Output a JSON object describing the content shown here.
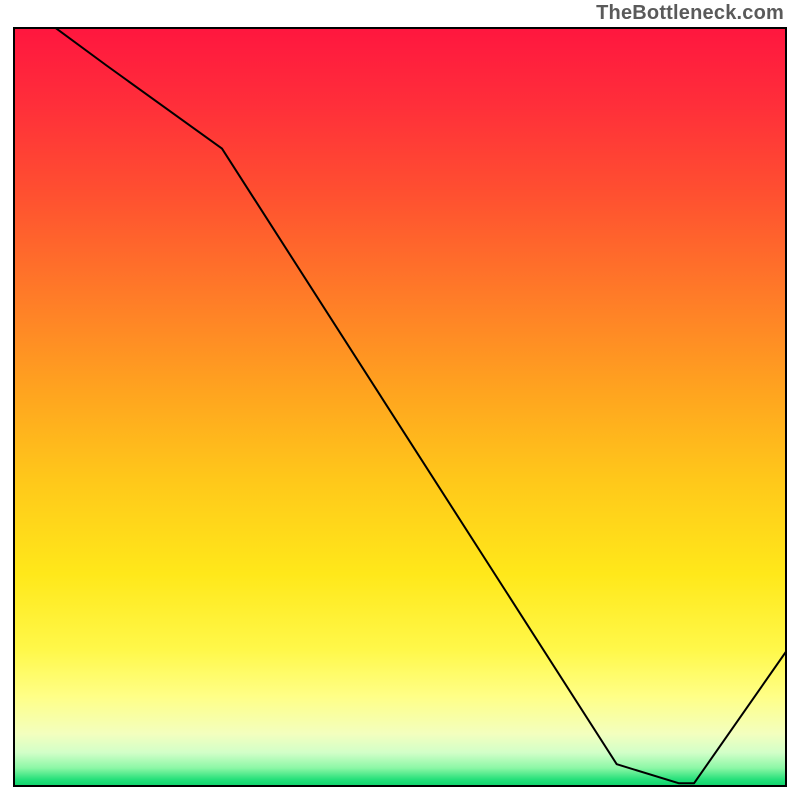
{
  "attribution": "TheBottleneck.com",
  "chart_data": {
    "type": "line",
    "title": "",
    "xlabel": "",
    "ylabel": "",
    "xlim": [
      0,
      100
    ],
    "ylim": [
      0,
      100
    ],
    "x": [
      0,
      12,
      27,
      78,
      86,
      88,
      100
    ],
    "values": [
      104,
      95,
      84,
      3,
      0.5,
      0.5,
      18
    ],
    "optimum_label": "",
    "gradient_stops": [
      {
        "offset": 0.0,
        "color": "#ff163f"
      },
      {
        "offset": 0.1,
        "color": "#ff2e3a"
      },
      {
        "offset": 0.22,
        "color": "#ff5030"
      },
      {
        "offset": 0.35,
        "color": "#ff7a28"
      },
      {
        "offset": 0.48,
        "color": "#ffa41f"
      },
      {
        "offset": 0.6,
        "color": "#ffc91a"
      },
      {
        "offset": 0.72,
        "color": "#ffe81a"
      },
      {
        "offset": 0.82,
        "color": "#fff84a"
      },
      {
        "offset": 0.88,
        "color": "#ffff86"
      },
      {
        "offset": 0.93,
        "color": "#f3ffbe"
      },
      {
        "offset": 0.955,
        "color": "#d2ffc8"
      },
      {
        "offset": 0.975,
        "color": "#8cf7a6"
      },
      {
        "offset": 0.99,
        "color": "#26e07a"
      },
      {
        "offset": 1.0,
        "color": "#0ad169"
      }
    ]
  }
}
